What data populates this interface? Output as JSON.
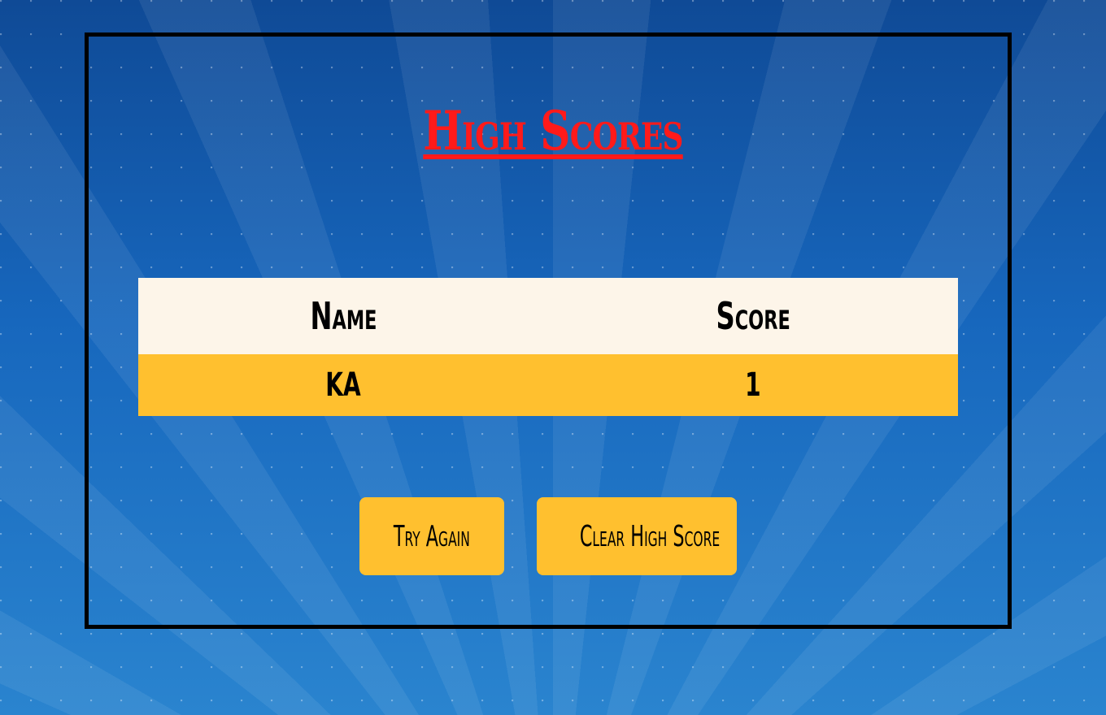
{
  "page": {
    "title": "High Scores"
  },
  "table": {
    "headers": [
      "Name",
      "Score"
    ],
    "rows": [
      {
        "name": "KA",
        "score": "1"
      }
    ]
  },
  "buttons": {
    "try_again": "Try Again",
    "clear_high_score": "Clear High Score"
  },
  "colors": {
    "title": "#ff1a1a",
    "header_bg": "#fdf5e9",
    "row_bg": "#ffc02f",
    "button_bg": "#ffc02f",
    "panel_border": "#000000",
    "background": "#1a63b3"
  }
}
